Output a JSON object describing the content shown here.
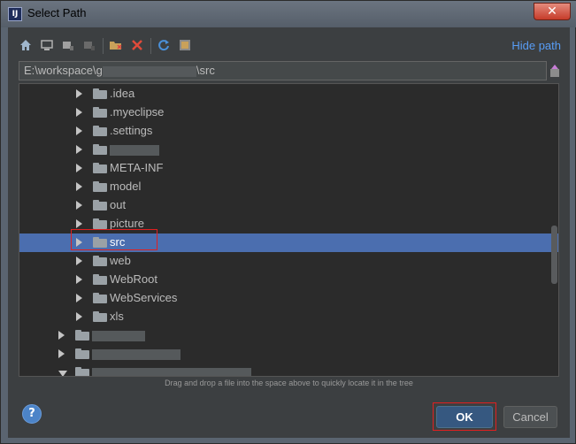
{
  "window": {
    "title": "Select Path",
    "close_glyph": "✕",
    "app_icon_text": "IJ"
  },
  "toolbar": {
    "icons": [
      "home-icon",
      "desktop-icon",
      "project-icon",
      "module-icon",
      "new-folder-icon",
      "delete-icon",
      "refresh-icon",
      "show-hidden-icon"
    ],
    "hide_path_label": "Hide path"
  },
  "path": {
    "prefix": "E:\\workspace\\g",
    "suffix": "\\src"
  },
  "tree": {
    "rows": [
      {
        "label": ".idea",
        "level": 2,
        "expanded": false,
        "selected": false,
        "blurred": false
      },
      {
        "label": ".myeclipse",
        "level": 2,
        "expanded": false,
        "selected": false,
        "blurred": false
      },
      {
        "label": ".settings",
        "level": 2,
        "expanded": false,
        "selected": false,
        "blurred": false
      },
      {
        "label": "",
        "level": 2,
        "expanded": false,
        "selected": false,
        "blurred": true
      },
      {
        "label": "META-INF",
        "level": 2,
        "expanded": false,
        "selected": false,
        "blurred": false
      },
      {
        "label": "model",
        "level": 2,
        "expanded": false,
        "selected": false,
        "blurred": false
      },
      {
        "label": "out",
        "level": 2,
        "expanded": false,
        "selected": false,
        "blurred": false
      },
      {
        "label": "picture",
        "level": 2,
        "expanded": false,
        "selected": false,
        "blurred": false
      },
      {
        "label": "src",
        "level": 2,
        "expanded": false,
        "selected": true,
        "blurred": false
      },
      {
        "label": "web",
        "level": 2,
        "expanded": false,
        "selected": false,
        "blurred": false
      },
      {
        "label": "WebRoot",
        "level": 2,
        "expanded": false,
        "selected": false,
        "blurred": false
      },
      {
        "label": "WebServices",
        "level": 2,
        "expanded": false,
        "selected": false,
        "blurred": false
      },
      {
        "label": "xls",
        "level": 2,
        "expanded": false,
        "selected": false,
        "blurred": false
      },
      {
        "label": "",
        "level": 1,
        "expanded": false,
        "selected": false,
        "blurred": true
      },
      {
        "label": "",
        "level": 1,
        "expanded": false,
        "selected": false,
        "blurred": true
      },
      {
        "label": "",
        "level": 1,
        "expanded": true,
        "selected": false,
        "blurred": true
      }
    ]
  },
  "hint": "Drag and drop a file into the space above to quickly locate it in the tree",
  "buttons": {
    "help": "?",
    "ok": "OK",
    "cancel": "Cancel"
  },
  "colors": {
    "selection": "#4b6eaf",
    "link": "#589df6",
    "highlight": "#e02020"
  }
}
